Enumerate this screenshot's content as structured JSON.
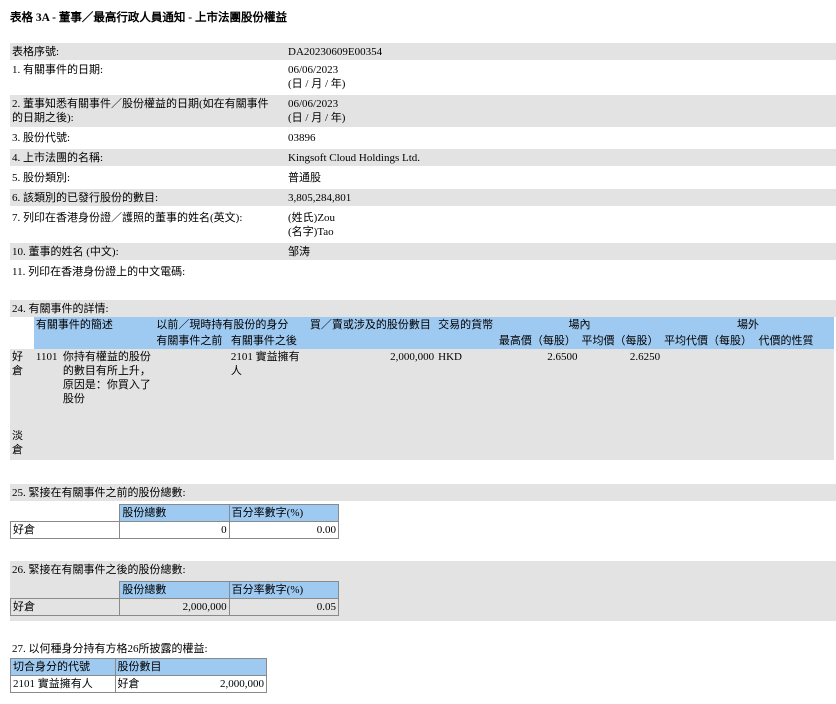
{
  "title": "表格 3A - 董事／最高行政人員通知 - 上市法團股份權益",
  "fields": [
    {
      "label": "表格序號:",
      "value": "DA20230609E00354"
    },
    {
      "label": "1. 有關事件的日期:",
      "value": "06/06/2023",
      "value2": "(日 / 月 / 年)"
    },
    {
      "label": "2. 董事知悉有關事件／股份權益的日期(如在有關事件",
      "label2": "的日期之後):",
      "value": "06/06/2023",
      "value2": "(日 / 月 / 年)"
    },
    {
      "label": "3. 股份代號:",
      "value": "03896"
    },
    {
      "label": "4. 上市法團的名稱:",
      "value": "Kingsoft Cloud Holdings Ltd."
    },
    {
      "label": "5. 股份類別:",
      "value": "普通股"
    },
    {
      "label": "6. 該類別的已發行股份的數目:",
      "value": "3,805,284,801"
    },
    {
      "label": "7. 列印在香港身份證／護照的董事的姓名(英文):",
      "value": "(姓氏)Zou",
      "value2": "(名字)Tao"
    },
    {
      "label": "10. 董事的姓名 (中文):",
      "value": "邹涛"
    }
  ],
  "field11": "11. 列印在香港身份證上的中文電碼:",
  "s24": {
    "heading": "24. 有關事件的詳情:",
    "h_event": "有關事件的簡述",
    "h_capacity": "以前／現時持有股份的身分",
    "h_before": "有關事件之前",
    "h_after": "有關事件之後",
    "h_shares": "買／賣或涉及的股份數目",
    "h_currency": "交易的貨幣",
    "h_onex": "場內",
    "h_high": "最高價（每股）",
    "h_avg": "平均價（每股）",
    "h_offex": "場外",
    "h_offavg": "平均代價（每股）",
    "h_consid": "代價的性質",
    "long": "好倉",
    "short": "淡倉",
    "row": {
      "code": "1101",
      "desc": "你持有權益的股份的數目有所上升，原因是：你買入了股份",
      "after": "2101 實益擁有人",
      "shares": "2,000,000",
      "currency": "HKD",
      "high": "2.6500",
      "avg": "2.6250"
    }
  },
  "s25": {
    "heading": "25. 緊接在有關事件之前的股份總數:",
    "h1": "股份總數",
    "h2": "百分率數字(%)",
    "row": "好倉",
    "shares": "0",
    "pct": "0.00"
  },
  "s26": {
    "heading": "26. 緊接在有關事件之後的股份總數:",
    "h1": "股份總數",
    "h2": "百分率數字(%)",
    "row": "好倉",
    "shares": "2,000,000",
    "pct": "0.05"
  },
  "s27": {
    "heading": "27. 以何種身分持有方格26所披露的權益:",
    "h1": "切合身分的代號",
    "h2": "股份數目",
    "code": "2101 實益擁有人",
    "pos": "好倉",
    "shares": "2,000,000"
  }
}
